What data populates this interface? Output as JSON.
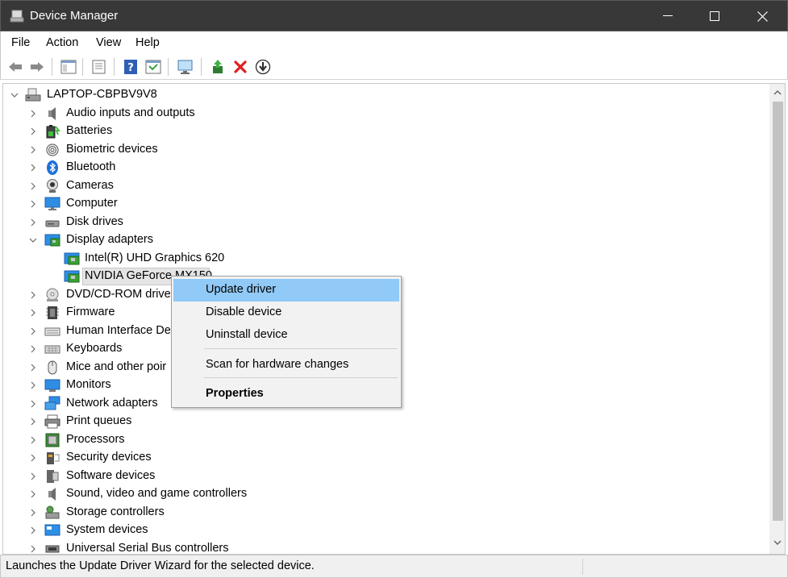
{
  "window": {
    "title": "Device Manager"
  },
  "menu": {
    "items": [
      "File",
      "Action",
      "View",
      "Help"
    ]
  },
  "tree": {
    "root": "LAPTOP-CBPBV9V8",
    "categories": [
      {
        "label": "Audio inputs and outputs",
        "icon": "speaker-icon"
      },
      {
        "label": "Batteries",
        "icon": "battery-icon"
      },
      {
        "label": "Biometric devices",
        "icon": "fingerprint-icon"
      },
      {
        "label": "Bluetooth",
        "icon": "bluetooth-icon"
      },
      {
        "label": "Cameras",
        "icon": "camera-icon"
      },
      {
        "label": "Computer",
        "icon": "computer-icon"
      },
      {
        "label": "Disk drives",
        "icon": "disk-drive-icon"
      },
      {
        "label": "Display adapters",
        "icon": "display-adapter-icon",
        "expanded": true
      },
      {
        "label": "DVD/CD-ROM drive",
        "icon": "dvd-icon"
      },
      {
        "label": "Firmware",
        "icon": "firmware-icon"
      },
      {
        "label": "Human Interface De",
        "icon": "hid-icon"
      },
      {
        "label": "Keyboards",
        "icon": "keyboard-icon"
      },
      {
        "label": "Mice and other poir",
        "icon": "mouse-icon"
      },
      {
        "label": "Monitors",
        "icon": "monitor-icon"
      },
      {
        "label": "Network adapters",
        "icon": "network-icon"
      },
      {
        "label": "Print queues",
        "icon": "printer-icon"
      },
      {
        "label": "Processors",
        "icon": "processor-icon"
      },
      {
        "label": "Security devices",
        "icon": "security-icon"
      },
      {
        "label": "Software devices",
        "icon": "software-icon"
      },
      {
        "label": "Sound, video and game controllers",
        "icon": "sound-icon"
      },
      {
        "label": "Storage controllers",
        "icon": "storage-icon"
      },
      {
        "label": "System devices",
        "icon": "system-icon"
      },
      {
        "label": "Universal Serial Bus controllers",
        "icon": "usb-icon"
      }
    ],
    "display_children": [
      {
        "label": "Intel(R) UHD Graphics 620"
      },
      {
        "label": "NVIDIA GeForce MX150",
        "selected": true
      }
    ]
  },
  "context_menu": {
    "items": [
      {
        "label": "Update driver",
        "highlighted": true
      },
      {
        "label": "Disable device"
      },
      {
        "label": "Uninstall device"
      },
      {
        "label": "Scan for hardware changes"
      },
      {
        "label": "Properties",
        "bold": true
      }
    ]
  },
  "status": {
    "text": "Launches the Update Driver Wizard for the selected device."
  },
  "colors": {
    "titlebar": "#383838",
    "highlight": "#91c9f7",
    "selection": "#e5e5e5"
  }
}
